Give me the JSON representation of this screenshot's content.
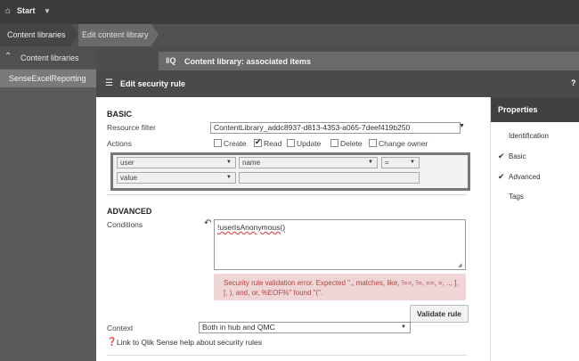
{
  "topbar": {
    "home_icon": "home-icon",
    "start_label": "Start",
    "caret_icon": "caret-down-icon"
  },
  "breadcrumb": {
    "items": [
      {
        "label": "Content libraries"
      },
      {
        "label": "Edit content library"
      }
    ]
  },
  "left_panel": {
    "header": "Content libraries",
    "items": [
      {
        "label": "SenseExcelReporting"
      }
    ]
  },
  "associated_header": {
    "title": "Content library: associated items"
  },
  "dialog": {
    "title": "Edit security rule",
    "help": "?",
    "basic": {
      "title": "BASIC",
      "resource_filter_label": "Resource filter",
      "resource_filter_value": "ContentLibrary_addc8937-d813-4353-a065-7deef419b250",
      "actions_label": "Actions",
      "actions": [
        {
          "label": "Create",
          "checked": false
        },
        {
          "label": "Read",
          "checked": true
        },
        {
          "label": "Update",
          "checked": false
        },
        {
          "label": "Delete",
          "checked": false
        },
        {
          "label": "Change owner",
          "checked": false
        }
      ],
      "filter_row1": {
        "subject": "user",
        "attribute": "name",
        "operator": "="
      },
      "filter_row2": {
        "field": "value",
        "input_value": ""
      }
    },
    "advanced": {
      "title": "ADVANCED",
      "conditions_label": "Conditions",
      "conditions_value": "!userIsAnonymous()",
      "error_text": "Security rule validation error. Expected \",, matches, like, !==, !=, ==, =, .., ], [, ), and, or, %EOF%\" found \"(\".",
      "validate_label": "Validate rule",
      "context_label": "Context",
      "context_value": "Both in hub and QMC",
      "help_link": "Link to Qlik Sense help about security rules"
    }
  },
  "properties": {
    "title": "Properties",
    "items": [
      {
        "label": "Identification",
        "checked": false
      },
      {
        "label": "Basic",
        "checked": true
      },
      {
        "label": "Advanced",
        "checked": true
      },
      {
        "label": "Tags",
        "checked": false
      }
    ]
  }
}
